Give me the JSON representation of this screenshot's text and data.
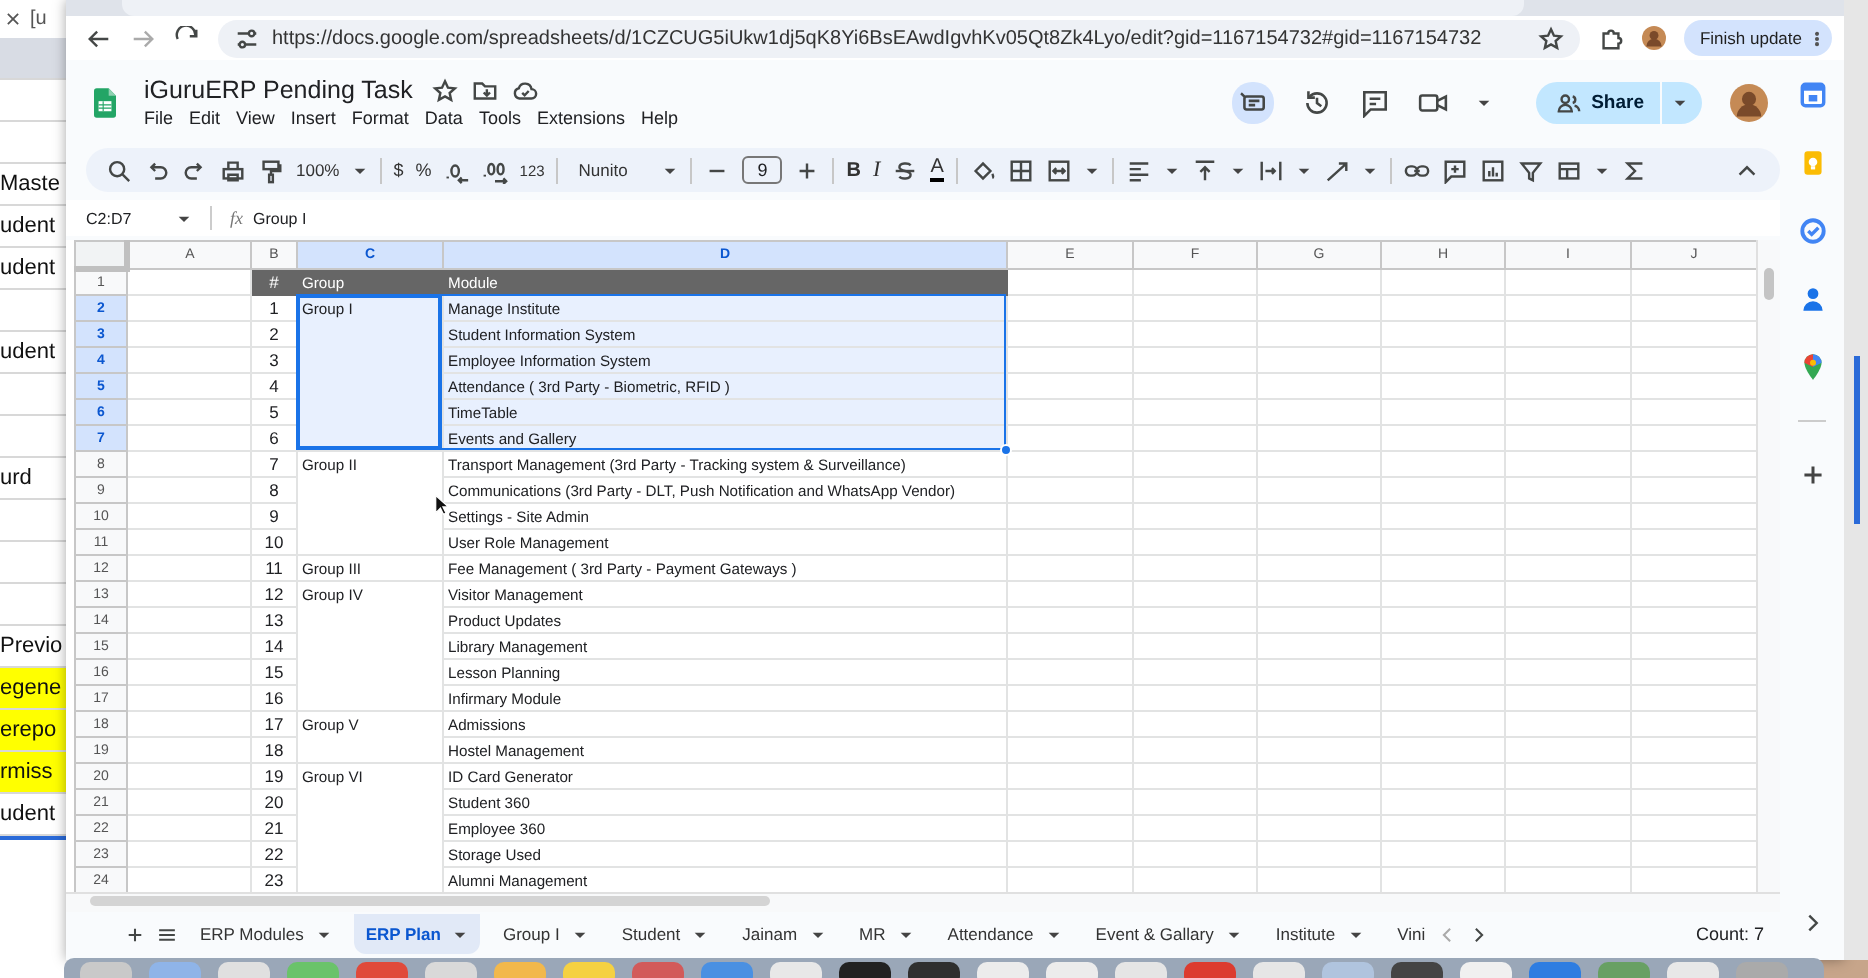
{
  "background_window": {
    "tab_fragment": "[u",
    "rows": [
      {
        "kind": "blank",
        "selected": true,
        "highlighted": false
      },
      {
        "kind": "blank",
        "selected": false,
        "highlighted": false
      },
      {
        "kind": "blank",
        "selected": false,
        "highlighted": false
      },
      {
        "kind": "text",
        "text": "Maste",
        "selected": false,
        "highlighted": false
      },
      {
        "kind": "text",
        "text": "udent",
        "selected": false,
        "highlighted": false
      },
      {
        "kind": "text",
        "text": "udent",
        "selected": false,
        "highlighted": false
      },
      {
        "kind": "blank",
        "selected": false,
        "highlighted": false
      },
      {
        "kind": "text",
        "text": "udent",
        "selected": false,
        "highlighted": false
      },
      {
        "kind": "blank",
        "selected": false,
        "highlighted": false
      },
      {
        "kind": "blank",
        "selected": false,
        "highlighted": false
      },
      {
        "kind": "text",
        "text": "urd",
        "selected": false,
        "highlighted": false
      },
      {
        "kind": "blank",
        "selected": false,
        "highlighted": false
      },
      {
        "kind": "blank",
        "selected": false,
        "highlighted": false
      },
      {
        "kind": "blank",
        "selected": false,
        "highlighted": false
      },
      {
        "kind": "text",
        "text": "Previo",
        "selected": false,
        "highlighted": false
      },
      {
        "kind": "text",
        "text": "egene",
        "selected": false,
        "highlighted": true
      },
      {
        "kind": "text",
        "text": "erepo",
        "selected": false,
        "highlighted": true
      },
      {
        "kind": "text",
        "text": "rmiss",
        "selected": false,
        "highlighted": true
      },
      {
        "kind": "text",
        "text": "udent",
        "selected": false,
        "highlighted": false
      }
    ]
  },
  "browser": {
    "url": "https://docs.google.com/spreadsheets/d/1CZCUG5iUkw1dj5qK8Yi6BsEAwdIgvhKv05Qt8Zk4Lyo/edit?gid=1167154732#gid=1167154732",
    "update_button": "Finish update"
  },
  "document": {
    "title": "iGuruERP Pending Task",
    "menu": [
      "File",
      "Edit",
      "View",
      "Insert",
      "Format",
      "Data",
      "Tools",
      "Extensions",
      "Help"
    ],
    "share_button": "Share"
  },
  "toolbar": {
    "zoom": "100%",
    "currency": "$",
    "percent": "%",
    "number_format": "123",
    "font": "Nunito",
    "font_size": "9",
    "bold": "B",
    "italic": "I",
    "text_color": "A"
  },
  "formula_bar": {
    "name_box": "C2:D7",
    "formula_icon": "fx",
    "formula": "Group I"
  },
  "grid": {
    "columns": [
      {
        "label": "A",
        "selected": false
      },
      {
        "label": "B",
        "selected": false
      },
      {
        "label": "C",
        "selected": true
      },
      {
        "label": "D",
        "selected": true
      },
      {
        "label": "E",
        "selected": false
      },
      {
        "label": "F",
        "selected": false
      },
      {
        "label": "G",
        "selected": false
      },
      {
        "label": "H",
        "selected": false
      },
      {
        "label": "I",
        "selected": false
      },
      {
        "label": "J",
        "selected": false
      }
    ],
    "rows": [
      {
        "n": "1",
        "kind": "header",
        "selected": false,
        "num": "#",
        "group": "Group",
        "module": "Module"
      },
      {
        "n": "2",
        "kind": "data",
        "selected": true,
        "num": "1",
        "group": "Group I",
        "module": "Manage Institute"
      },
      {
        "n": "3",
        "kind": "data",
        "selected": true,
        "num": "2",
        "module": "Student Information System"
      },
      {
        "n": "4",
        "kind": "data",
        "selected": true,
        "num": "3",
        "module": "Employee Information System"
      },
      {
        "n": "5",
        "kind": "data",
        "selected": true,
        "num": "4",
        "module": "Attendance ( 3rd Party - Biometric, RFID )"
      },
      {
        "n": "6",
        "kind": "data",
        "selected": true,
        "num": "5",
        "module": "TimeTable"
      },
      {
        "n": "7",
        "kind": "data",
        "selected": true,
        "num": "6",
        "module": "Events and Gallery"
      },
      {
        "n": "8",
        "kind": "data",
        "selected": false,
        "num": "7",
        "group": "Group II",
        "module": "Transport Management (3rd Party - Tracking system & Surveillance)"
      },
      {
        "n": "9",
        "kind": "data",
        "selected": false,
        "num": "8",
        "module": "Communications (3rd Party - DLT, Push Notification and WhatsApp Vendor)"
      },
      {
        "n": "10",
        "kind": "data",
        "selected": false,
        "num": "9",
        "module": "Settings - Site Admin"
      },
      {
        "n": "11",
        "kind": "data",
        "selected": false,
        "num": "10",
        "module": "User Role Management"
      },
      {
        "n": "12",
        "kind": "data",
        "selected": false,
        "num": "11",
        "group": "Group III",
        "module": "Fee Management ( 3rd Party - Payment Gateways )"
      },
      {
        "n": "13",
        "kind": "data",
        "selected": false,
        "num": "12",
        "group": "Group IV",
        "module": "Visitor Management"
      },
      {
        "n": "14",
        "kind": "data",
        "selected": false,
        "num": "13",
        "module": "Product Updates"
      },
      {
        "n": "15",
        "kind": "data",
        "selected": false,
        "num": "14",
        "module": "Library Management"
      },
      {
        "n": "16",
        "kind": "data",
        "selected": false,
        "num": "15",
        "module": "Lesson Planning"
      },
      {
        "n": "17",
        "kind": "data",
        "selected": false,
        "num": "16",
        "module": "Infirmary Module"
      },
      {
        "n": "18",
        "kind": "data",
        "selected": false,
        "num": "17",
        "group": "Group V",
        "module": "Admissions"
      },
      {
        "n": "19",
        "kind": "data",
        "selected": false,
        "num": "18",
        "module": "Hostel Management"
      },
      {
        "n": "20",
        "kind": "data",
        "selected": false,
        "num": "19",
        "group": "Group VI",
        "module": "ID Card Generator"
      },
      {
        "n": "21",
        "kind": "data",
        "selected": false,
        "num": "20",
        "module": "Student 360"
      },
      {
        "n": "22",
        "kind": "data",
        "selected": false,
        "num": "21",
        "module": "Employee 360"
      },
      {
        "n": "23",
        "kind": "data",
        "selected": false,
        "num": "22",
        "module": "Storage Used"
      },
      {
        "n": "24",
        "kind": "data",
        "selected": false,
        "num": "23",
        "module": "Alumni Management"
      }
    ]
  },
  "sheet_tabs": [
    {
      "label": "ERP Modules",
      "selected": false
    },
    {
      "label": "ERP Plan",
      "selected": true
    },
    {
      "label": "Group I",
      "selected": false
    },
    {
      "label": "Student",
      "selected": false
    },
    {
      "label": "Jainam",
      "selected": false
    },
    {
      "label": "MR",
      "selected": false
    },
    {
      "label": "Attendance",
      "selected": false
    },
    {
      "label": "Event & Gallary",
      "selected": false
    },
    {
      "label": "Institute",
      "selected": false
    },
    {
      "label": "Vini",
      "kind": "cut",
      "selected": false
    }
  ],
  "status": "Count: 7"
}
